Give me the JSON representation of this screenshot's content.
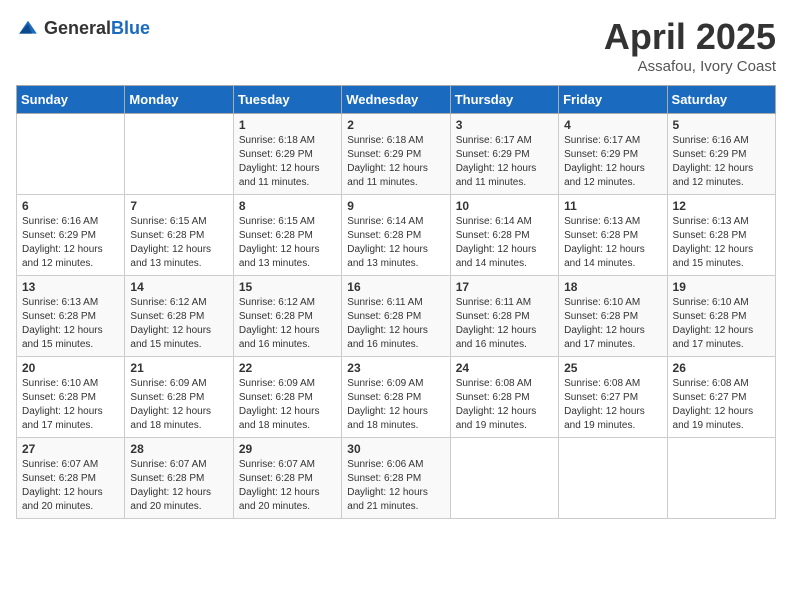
{
  "header": {
    "logo_general": "General",
    "logo_blue": "Blue",
    "title": "April 2025",
    "subtitle": "Assafou, Ivory Coast"
  },
  "weekdays": [
    "Sunday",
    "Monday",
    "Tuesday",
    "Wednesday",
    "Thursday",
    "Friday",
    "Saturday"
  ],
  "weeks": [
    [
      {
        "day": "",
        "info": ""
      },
      {
        "day": "",
        "info": ""
      },
      {
        "day": "1",
        "info": "Sunrise: 6:18 AM\nSunset: 6:29 PM\nDaylight: 12 hours and 11 minutes."
      },
      {
        "day": "2",
        "info": "Sunrise: 6:18 AM\nSunset: 6:29 PM\nDaylight: 12 hours and 11 minutes."
      },
      {
        "day": "3",
        "info": "Sunrise: 6:17 AM\nSunset: 6:29 PM\nDaylight: 12 hours and 11 minutes."
      },
      {
        "day": "4",
        "info": "Sunrise: 6:17 AM\nSunset: 6:29 PM\nDaylight: 12 hours and 12 minutes."
      },
      {
        "day": "5",
        "info": "Sunrise: 6:16 AM\nSunset: 6:29 PM\nDaylight: 12 hours and 12 minutes."
      }
    ],
    [
      {
        "day": "6",
        "info": "Sunrise: 6:16 AM\nSunset: 6:29 PM\nDaylight: 12 hours and 12 minutes."
      },
      {
        "day": "7",
        "info": "Sunrise: 6:15 AM\nSunset: 6:28 PM\nDaylight: 12 hours and 13 minutes."
      },
      {
        "day": "8",
        "info": "Sunrise: 6:15 AM\nSunset: 6:28 PM\nDaylight: 12 hours and 13 minutes."
      },
      {
        "day": "9",
        "info": "Sunrise: 6:14 AM\nSunset: 6:28 PM\nDaylight: 12 hours and 13 minutes."
      },
      {
        "day": "10",
        "info": "Sunrise: 6:14 AM\nSunset: 6:28 PM\nDaylight: 12 hours and 14 minutes."
      },
      {
        "day": "11",
        "info": "Sunrise: 6:13 AM\nSunset: 6:28 PM\nDaylight: 12 hours and 14 minutes."
      },
      {
        "day": "12",
        "info": "Sunrise: 6:13 AM\nSunset: 6:28 PM\nDaylight: 12 hours and 15 minutes."
      }
    ],
    [
      {
        "day": "13",
        "info": "Sunrise: 6:13 AM\nSunset: 6:28 PM\nDaylight: 12 hours and 15 minutes."
      },
      {
        "day": "14",
        "info": "Sunrise: 6:12 AM\nSunset: 6:28 PM\nDaylight: 12 hours and 15 minutes."
      },
      {
        "day": "15",
        "info": "Sunrise: 6:12 AM\nSunset: 6:28 PM\nDaylight: 12 hours and 16 minutes."
      },
      {
        "day": "16",
        "info": "Sunrise: 6:11 AM\nSunset: 6:28 PM\nDaylight: 12 hours and 16 minutes."
      },
      {
        "day": "17",
        "info": "Sunrise: 6:11 AM\nSunset: 6:28 PM\nDaylight: 12 hours and 16 minutes."
      },
      {
        "day": "18",
        "info": "Sunrise: 6:10 AM\nSunset: 6:28 PM\nDaylight: 12 hours and 17 minutes."
      },
      {
        "day": "19",
        "info": "Sunrise: 6:10 AM\nSunset: 6:28 PM\nDaylight: 12 hours and 17 minutes."
      }
    ],
    [
      {
        "day": "20",
        "info": "Sunrise: 6:10 AM\nSunset: 6:28 PM\nDaylight: 12 hours and 17 minutes."
      },
      {
        "day": "21",
        "info": "Sunrise: 6:09 AM\nSunset: 6:28 PM\nDaylight: 12 hours and 18 minutes."
      },
      {
        "day": "22",
        "info": "Sunrise: 6:09 AM\nSunset: 6:28 PM\nDaylight: 12 hours and 18 minutes."
      },
      {
        "day": "23",
        "info": "Sunrise: 6:09 AM\nSunset: 6:28 PM\nDaylight: 12 hours and 18 minutes."
      },
      {
        "day": "24",
        "info": "Sunrise: 6:08 AM\nSunset: 6:28 PM\nDaylight: 12 hours and 19 minutes."
      },
      {
        "day": "25",
        "info": "Sunrise: 6:08 AM\nSunset: 6:27 PM\nDaylight: 12 hours and 19 minutes."
      },
      {
        "day": "26",
        "info": "Sunrise: 6:08 AM\nSunset: 6:27 PM\nDaylight: 12 hours and 19 minutes."
      }
    ],
    [
      {
        "day": "27",
        "info": "Sunrise: 6:07 AM\nSunset: 6:28 PM\nDaylight: 12 hours and 20 minutes."
      },
      {
        "day": "28",
        "info": "Sunrise: 6:07 AM\nSunset: 6:28 PM\nDaylight: 12 hours and 20 minutes."
      },
      {
        "day": "29",
        "info": "Sunrise: 6:07 AM\nSunset: 6:28 PM\nDaylight: 12 hours and 20 minutes."
      },
      {
        "day": "30",
        "info": "Sunrise: 6:06 AM\nSunset: 6:28 PM\nDaylight: 12 hours and 21 minutes."
      },
      {
        "day": "",
        "info": ""
      },
      {
        "day": "",
        "info": ""
      },
      {
        "day": "",
        "info": ""
      }
    ]
  ]
}
